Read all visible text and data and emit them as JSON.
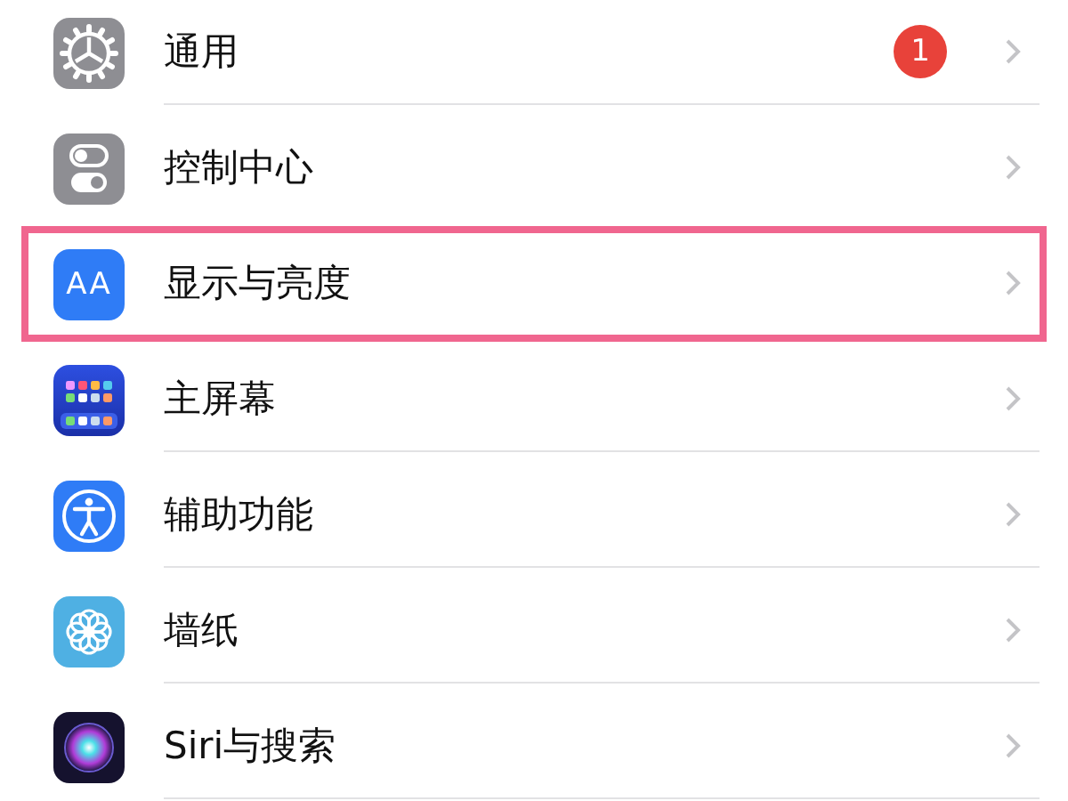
{
  "settings_items": [
    {
      "label": "通用",
      "badge": "1",
      "highlighted": false
    },
    {
      "label": "控制中心",
      "highlighted": false
    },
    {
      "label": "显示与亮度",
      "icon_text": "AA",
      "highlighted": true
    },
    {
      "label": "主屏幕",
      "highlighted": false
    },
    {
      "label": "辅助功能",
      "highlighted": false
    },
    {
      "label": "墙纸",
      "highlighted": false
    },
    {
      "label": "Siri与搜索",
      "highlighted": false
    }
  ]
}
